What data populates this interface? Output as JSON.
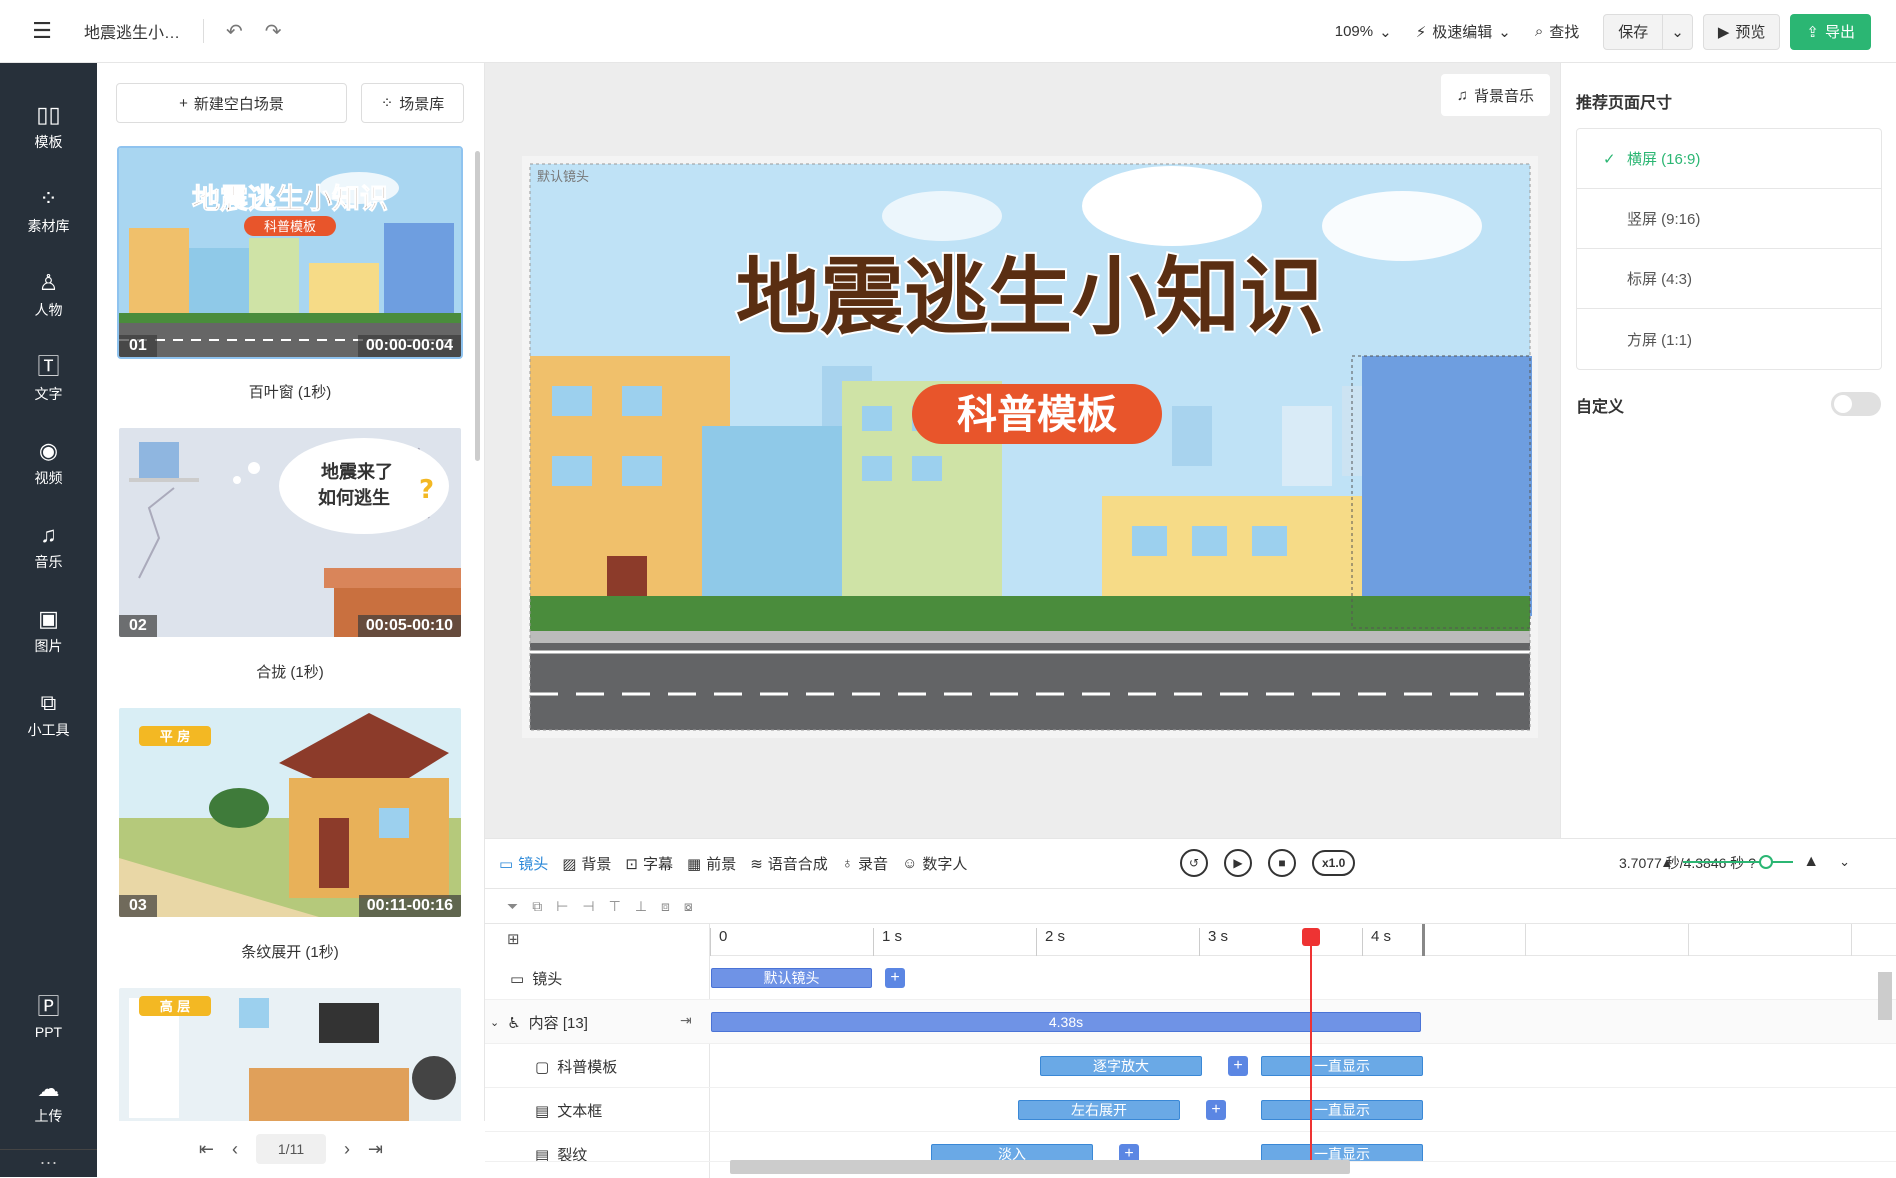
{
  "topbar": {
    "title": "地震逃生小知...",
    "zoom": "109%",
    "edit_mode": "极速编辑",
    "find": "查找",
    "save": "保存",
    "preview": "预览",
    "export": "导出"
  },
  "nav": [
    {
      "icon": "template-icon",
      "label": "模板"
    },
    {
      "icon": "library-icon",
      "label": "素材库"
    },
    {
      "icon": "person-icon",
      "label": "人物"
    },
    {
      "icon": "text-icon",
      "label": "文字"
    },
    {
      "icon": "video-icon",
      "label": "视频"
    },
    {
      "icon": "music-icon",
      "label": "音乐"
    },
    {
      "icon": "image-icon",
      "label": "图片"
    },
    {
      "icon": "tool-icon",
      "label": "小工具"
    },
    {
      "icon": "ppt-icon",
      "label": "PPT"
    },
    {
      "icon": "upload-icon",
      "label": "上传"
    }
  ],
  "scenes_panel": {
    "new_blank": "新建空白场景",
    "library": "场景库",
    "scenes": [
      {
        "num": "01",
        "time": "00:00-00:04",
        "label": "百叶窗 (1秒)",
        "title": "地震逃生小知识",
        "badge": "科普模板"
      },
      {
        "num": "02",
        "time": "00:05-00:10",
        "label": "合拢 (1秒)",
        "bubble1": "地震来了",
        "bubble2": "如何逃生"
      },
      {
        "num": "03",
        "time": "00:11-00:16",
        "label": "条纹展开 (1秒)",
        "tag": "平 房"
      },
      {
        "tag": "高 层"
      }
    ],
    "page": "1/11"
  },
  "canvas": {
    "bgm": "背景音乐",
    "default_shot": "默认镜头",
    "title": "地震逃生小知识",
    "badge": "科普模板"
  },
  "right_panel": {
    "heading": "推荐页面尺寸",
    "options": [
      "横屏 (16:9)",
      "竖屏 (9:16)",
      "标屏 (4:3)",
      "方屏 (1:1)"
    ],
    "selected": 0,
    "custom": "自定义"
  },
  "timeline": {
    "tabs": [
      "镜头",
      "背景",
      "字幕",
      "前景",
      "语音合成",
      "录音",
      "数字人"
    ],
    "speed": "x1.0",
    "time": "3.7077 秒/4.3846 秒",
    "ruler": [
      "0",
      "1 s",
      "2 s",
      "3 s",
      "4 s"
    ],
    "rows": [
      {
        "label": "镜头",
        "clips": [
          "默认镜头"
        ]
      },
      {
        "label": "内容 [13]",
        "clips": [
          "4.38s"
        ]
      },
      {
        "label": "科普模板",
        "clips": [
          "逐字放大",
          "一直显示"
        ]
      },
      {
        "label": "文本框",
        "clips": [
          "左右展开",
          "一直显示"
        ]
      },
      {
        "label": "裂纹",
        "clips": [
          "淡入",
          "一直显示"
        ]
      }
    ]
  }
}
